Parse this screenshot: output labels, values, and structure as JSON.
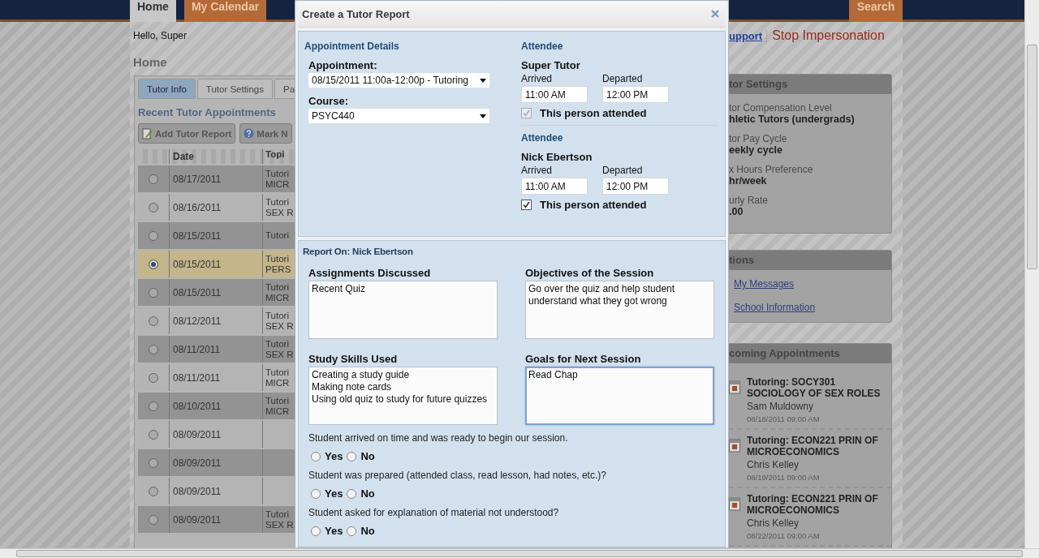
{
  "nav": {
    "tabs": [
      {
        "label": "Home",
        "selected": true
      },
      {
        "label": "My Calendar",
        "selected": false
      }
    ],
    "search": "Search"
  },
  "greeting": "Hello, Super",
  "page_title": "Home",
  "panel_tabs": [
    {
      "label": "Tutor Info",
      "selected": true
    },
    {
      "label": "Tutor Settings",
      "selected": false
    },
    {
      "label": "Pa",
      "selected": false
    }
  ],
  "section_title": "Recent Tutor Appointments",
  "toolbar": [
    {
      "label": "Add Tutor Report",
      "kind": "report"
    },
    {
      "label": "Mark N",
      "kind": "help"
    }
  ],
  "table": {
    "columns": [
      "Date",
      "Topi"
    ],
    "rows": [
      {
        "selected": false,
        "date": "08/17/2011",
        "topic": [
          "Tutori",
          "MICR"
        ]
      },
      {
        "selected": false,
        "date": "08/16/2011",
        "topic": [
          "Tutori",
          "SEX R"
        ]
      },
      {
        "selected": false,
        "date": "08/15/2011",
        "topic": [
          "Tutori"
        ]
      },
      {
        "selected": true,
        "date": "08/15/2011",
        "topic": [
          "Tutori",
          "PERS"
        ]
      },
      {
        "selected": false,
        "date": "08/15/2011",
        "topic": [
          "Tutori",
          "MICR"
        ]
      },
      {
        "selected": false,
        "date": "08/12/2011",
        "topic": [
          "Tutori",
          "SEX R"
        ]
      },
      {
        "selected": false,
        "date": "08/11/2011",
        "topic": [
          "Tutori",
          "SEX R"
        ]
      },
      {
        "selected": false,
        "date": "08/11/2011",
        "topic": [
          "Tutori",
          "MICR"
        ]
      },
      {
        "selected": false,
        "date": "08/10/2011",
        "topic": [
          "Tutori",
          "MICR"
        ]
      },
      {
        "selected": false,
        "date": "08/09/2011"
      },
      {
        "selected": false,
        "date": "08/09/2011"
      },
      {
        "selected": false,
        "date": "08/09/2011"
      },
      {
        "selected": false,
        "date": "08/09/2011",
        "topic": [
          "Tutori",
          "SEX R"
        ]
      }
    ]
  },
  "top_links": {
    "support": "upport",
    "stop": "Stop Impersonation"
  },
  "settings_panel": {
    "title": "tor Settings",
    "items": [
      {
        "label": "tor Compensation Level",
        "value": "hletic Tutors (undergrads)"
      },
      {
        "label": "tor Pay Cycle",
        "value": "eekly cycle"
      },
      {
        "label": "x Hours Preference",
        "value": "hr/week"
      },
      {
        "label": "urly Rate",
        "value": ".00"
      }
    ]
  },
  "links_panel": {
    "title": "tions",
    "links": [
      "My Messages",
      "School Information"
    ]
  },
  "appointments_panel": {
    "title": "coming Appointments",
    "items": [
      {
        "title": "Tutoring: SOCY301 SOCIOLOGY OF SEX ROLES",
        "person": "Sam Muldowny",
        "when": "08/18/2011 09:00 AM"
      },
      {
        "title": "Tutoring: ECON221 PRIN OF MICROECONOMICS",
        "person": "Chris Kelley",
        "when": "08/19/2011 09:00 AM"
      },
      {
        "title": "Tutoring: ECON221 PRIN OF MICROECONOMICS",
        "person": "Chris Kelley",
        "when": "08/22/2011 09:00 AM"
      }
    ]
  },
  "dialog": {
    "title": "Create a Tutor Report",
    "details": {
      "heading": "Appointment Details",
      "fields": [
        {
          "label": "Appointment:",
          "value": "08/15/2011 11:00a-12:00p - Tutoring"
        },
        {
          "label": "Course:",
          "value": "PSYC440"
        }
      ]
    },
    "attendees": [
      {
        "heading": "Attendee",
        "name": "Super Tutor",
        "arrived_label": "Arrived",
        "arrived": "11:00 AM",
        "departed_label": "Departed",
        "departed": "12:00 PM",
        "attended_label": "This person attended",
        "attended": true,
        "disabled": true
      },
      {
        "heading": "Attendee",
        "name": "Nick Ebertson",
        "arrived_label": "Arrived",
        "arrived": "11:00 AM",
        "departed_label": "Departed",
        "departed": "12:00 PM",
        "attended_label": "This person attended",
        "attended": true,
        "disabled": false
      }
    ],
    "report": {
      "heading": "Report On: Nick Ebertson",
      "notes": [
        {
          "label": "Assignments Discussed",
          "value": "Recent Quiz",
          "focused": false
        },
        {
          "label": "Objectives of the Session",
          "value": "Go over the quiz and help student\nunderstand what they got wrong",
          "focused": false
        },
        {
          "label": "Study Skills Used",
          "value": "Creating a study guide\nMaking note cards\nUsing old quiz to study for future quizzes",
          "focused": false
        },
        {
          "label": "Goals for Next Session",
          "value": "Read Chap",
          "focused": true
        }
      ],
      "questions": [
        {
          "text": "Student arrived on time and was ready to begin our session.",
          "options": [
            {
              "label": "Yes",
              "selected": false
            },
            {
              "label": "No",
              "selected": false
            }
          ]
        },
        {
          "text": "Student was prepared (attended class, read lesson, had notes, etc.)?",
          "options": [
            {
              "label": "Yes",
              "selected": false
            },
            {
              "label": "No",
              "selected": false
            }
          ]
        },
        {
          "text": "Student asked for explanation of material not understood?",
          "options": [
            {
              "label": "Yes",
              "selected": false
            },
            {
              "label": "No",
              "selected": false
            }
          ]
        }
      ]
    }
  }
}
